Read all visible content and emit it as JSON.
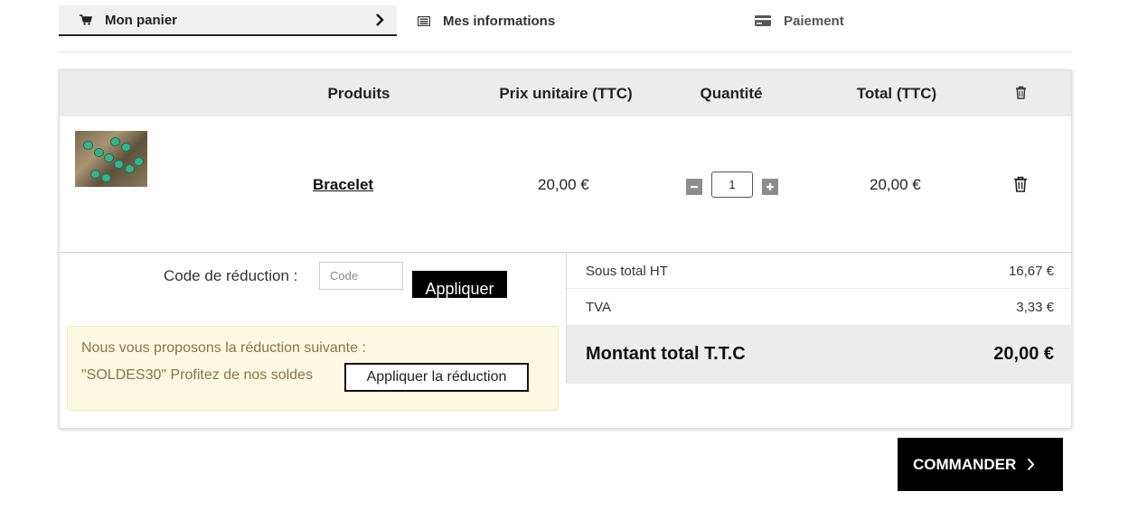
{
  "steps": [
    {
      "label": "Mon panier",
      "icon": "cart-icon",
      "active": true
    },
    {
      "label": "Mes informations",
      "icon": "list-icon",
      "active": false
    },
    {
      "label": "Paiement",
      "icon": "credit-card-icon",
      "active": false
    }
  ],
  "table": {
    "headers": {
      "products": "Produits",
      "unit_price": "Prix unitaire (TTC)",
      "quantity": "Quantité",
      "total": "Total (TTC)",
      "delete_icon": "trash-icon"
    },
    "rows": [
      {
        "product": "Bracelet",
        "image": "bracelet-photo",
        "unit_price": "20,00 €",
        "quantity": "1",
        "total": "20,00 €"
      }
    ]
  },
  "discount": {
    "label": "Code de réduction :",
    "placeholder": "Code",
    "apply_label": "Appliquer",
    "promo_line1": "Nous vous proposons la réduction suivante :",
    "promo_line2": "\"SOLDES30\" Profitez de nos soldes",
    "promo_button": "Appliquer la réduction"
  },
  "summary": {
    "subtotal_label": "Sous total HT",
    "subtotal_value": "16,67 €",
    "tax_label": "TVA",
    "tax_value": "3,33 €",
    "grand_label": "Montant total T.T.C",
    "grand_value": "20,00 €"
  },
  "checkout": {
    "label": "COMMANDER"
  },
  "colors": {
    "accent": "#000000",
    "header_bg": "#ececec",
    "promo_bg": "#fcf8e3",
    "promo_text": "#8a7346"
  }
}
